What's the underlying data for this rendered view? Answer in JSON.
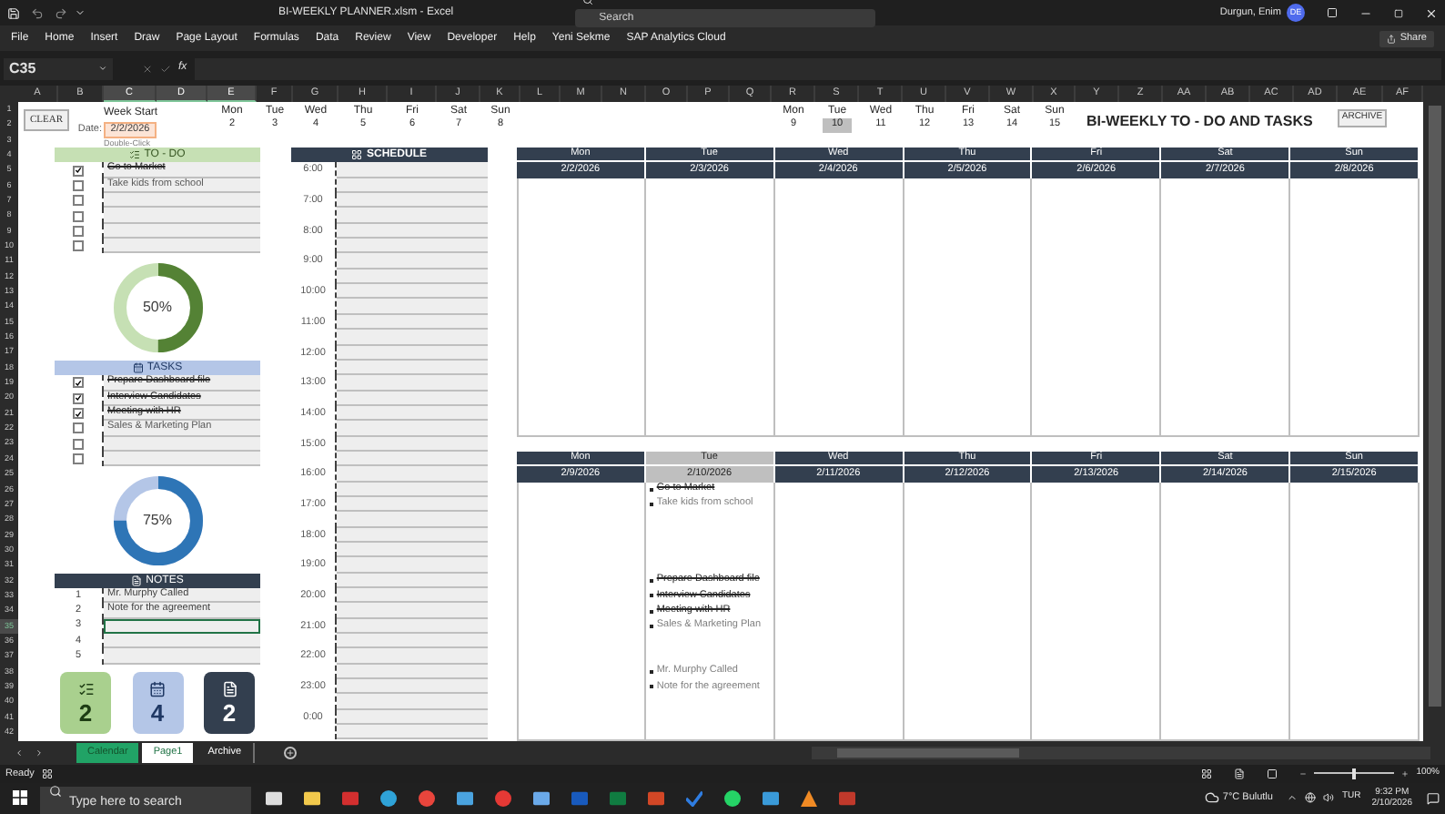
{
  "title_bar": {
    "title": "BI-WEEKLY PLANNER.xlsm - Excel",
    "search_placeholder": "Search",
    "user": "Durgun, Enim",
    "avatar": "DE"
  },
  "ribbon": {
    "tabs": [
      "File",
      "Home",
      "Insert",
      "Draw",
      "Page Layout",
      "Formulas",
      "Data",
      "Review",
      "View",
      "Developer",
      "Help",
      "Yeni Sekme",
      "SAP Analytics Cloud"
    ],
    "share": "Share"
  },
  "formula_bar": {
    "name_box": "C35",
    "function_label": "fx"
  },
  "columns": [
    {
      "label": "A",
      "selected": false
    },
    {
      "label": "B",
      "selected": false
    },
    {
      "label": "C",
      "selected": true
    },
    {
      "label": "D",
      "selected": true
    },
    {
      "label": "E",
      "selected": true
    },
    {
      "label": "F",
      "selected": false
    },
    {
      "label": "G",
      "selected": false
    },
    {
      "label": "H",
      "selected": false
    },
    {
      "label": "I",
      "selected": false
    },
    {
      "label": "J",
      "selected": false
    },
    {
      "label": "K",
      "selected": false
    },
    {
      "label": "L",
      "selected": false
    },
    {
      "label": "M",
      "selected": false
    },
    {
      "label": "N",
      "selected": false
    },
    {
      "label": "O",
      "selected": false
    },
    {
      "label": "P",
      "selected": false
    },
    {
      "label": "Q",
      "selected": false
    },
    {
      "label": "R",
      "selected": false
    },
    {
      "label": "S",
      "selected": false
    },
    {
      "label": "T",
      "selected": false
    },
    {
      "label": "U",
      "selected": false
    },
    {
      "label": "V",
      "selected": false
    },
    {
      "label": "W",
      "selected": false
    },
    {
      "label": "X",
      "selected": false
    },
    {
      "label": "Y",
      "selected": false
    },
    {
      "label": "Z",
      "selected": false
    },
    {
      "label": "AA",
      "selected": false
    },
    {
      "label": "AB",
      "selected": false
    },
    {
      "label": "AC",
      "selected": false
    },
    {
      "label": "AD",
      "selected": false
    },
    {
      "label": "AE",
      "selected": false
    },
    {
      "label": "AF",
      "selected": false
    }
  ],
  "rows": [
    {
      "label": "1",
      "selected": false
    },
    {
      "label": "2",
      "selected": false
    },
    {
      "label": "3",
      "selected": false
    },
    {
      "label": "4",
      "selected": false
    },
    {
      "label": "5",
      "selected": false
    },
    {
      "label": "6",
      "selected": false
    },
    {
      "label": "7",
      "selected": false
    },
    {
      "label": "8",
      "selected": false
    },
    {
      "label": "9",
      "selected": false
    },
    {
      "label": "10",
      "selected": false
    },
    {
      "label": "11",
      "selected": false
    },
    {
      "label": "12",
      "selected": false
    },
    {
      "label": "13",
      "selected": false
    },
    {
      "label": "14",
      "selected": false
    },
    {
      "label": "15",
      "selected": false
    },
    {
      "label": "16",
      "selected": false
    },
    {
      "label": "17",
      "selected": false
    },
    {
      "label": "18",
      "selected": false
    },
    {
      "label": "19",
      "selected": false
    },
    {
      "label": "20",
      "selected": false
    },
    {
      "label": "21",
      "selected": false
    },
    {
      "label": "22",
      "selected": false
    },
    {
      "label": "23",
      "selected": false
    },
    {
      "label": "24",
      "selected": false
    },
    {
      "label": "25",
      "selected": false
    },
    {
      "label": "26",
      "selected": false
    },
    {
      "label": "27",
      "selected": false
    },
    {
      "label": "28",
      "selected": false
    },
    {
      "label": "29",
      "selected": false
    },
    {
      "label": "30",
      "selected": false
    },
    {
      "label": "31",
      "selected": false
    },
    {
      "label": "32",
      "selected": false
    },
    {
      "label": "33",
      "selected": false
    },
    {
      "label": "34",
      "selected": false
    },
    {
      "label": "35",
      "selected": true
    },
    {
      "label": "36",
      "selected": false
    },
    {
      "label": "37",
      "selected": false
    },
    {
      "label": "38",
      "selected": false
    },
    {
      "label": "39",
      "selected": false
    },
    {
      "label": "40",
      "selected": false
    },
    {
      "label": "41",
      "selected": false
    },
    {
      "label": "42",
      "selected": false
    }
  ],
  "sheet": {
    "clear_button": "CLEAR",
    "week_start_label": "Week Start",
    "date_label": "Date:",
    "date_value": "2/2/2026",
    "date_hint": "Double-Click",
    "week_strips": [
      {
        "days": [
          {
            "day": "Mon",
            "number": "2",
            "selected": false
          },
          {
            "day": "Tue",
            "number": "3",
            "selected": false
          },
          {
            "day": "Wed",
            "number": "4",
            "selected": false
          },
          {
            "day": "Thu",
            "number": "5",
            "selected": false
          },
          {
            "day": "Fri",
            "number": "6",
            "selected": false
          },
          {
            "day": "Sat",
            "number": "7",
            "selected": false
          },
          {
            "day": "Sun",
            "number": "8",
            "selected": false
          }
        ]
      },
      {
        "days": [
          {
            "day": "Mon",
            "number": "9",
            "selected": false
          },
          {
            "day": "Tue",
            "number": "10",
            "selected": true
          },
          {
            "day": "Wed",
            "number": "11",
            "selected": false
          },
          {
            "day": "Thu",
            "number": "12",
            "selected": false
          },
          {
            "day": "Fri",
            "number": "13",
            "selected": false
          },
          {
            "day": "Sat",
            "number": "14",
            "selected": false
          },
          {
            "day": "Sun",
            "number": "15",
            "selected": false
          }
        ]
      }
    ],
    "title": "BI-WEEKLY TO - DO AND TASKS",
    "archive_button": "ARCHIVE",
    "todo": {
      "title": "TO - DO",
      "items": [
        {
          "text": "Go to Market",
          "checked": true
        },
        {
          "text": "Take kids from school",
          "checked": false
        },
        {
          "checked": false
        },
        {
          "checked": false
        },
        {
          "checked": false
        },
        {
          "checked": false
        }
      ],
      "level": 0.5,
      "percent": "50%"
    },
    "tasks": {
      "title": "TASKS",
      "items": [
        {
          "text": "Prepare Dashboard file",
          "checked": true
        },
        {
          "text": "Interview Candidates",
          "checked": true
        },
        {
          "text": "Meeting with HR",
          "checked": true
        },
        {
          "text": "Sales & Marketing Plan",
          "checked": false
        },
        {
          "checked": false
        },
        {
          "checked": false
        }
      ],
      "level": 0.75,
      "percent": "75%"
    },
    "notes": {
      "title": "NOTES",
      "items": [
        {
          "number": "1",
          "text": "Mr. Murphy Called",
          "selected": false
        },
        {
          "number": "2",
          "text": "Note for the agreement",
          "selected": false
        },
        {
          "number": "3",
          "selected": true
        },
        {
          "number": "4",
          "selected": false
        },
        {
          "number": "5",
          "selected": false
        }
      ]
    },
    "counters": [
      {
        "kind": "todo",
        "count": "2"
      },
      {
        "kind": "tasks",
        "count": "4"
      },
      {
        "kind": "notes",
        "count": "2"
      }
    ],
    "schedule": {
      "title": "SCHEDULE",
      "times": [
        "6:00",
        "7:00",
        "8:00",
        "9:00",
        "10:00",
        "11:00",
        "12:00",
        "13:00",
        "14:00",
        "15:00",
        "16:00",
        "17:00",
        "18:00",
        "19:00",
        "20:00",
        "21:00",
        "22:00",
        "23:00",
        "0:00"
      ]
    },
    "calendar_weeks": [
      {
        "days": [
          {
            "day": "Mon",
            "date": "2/2/2026",
            "selected": false
          },
          {
            "day": "Tue",
            "date": "2/3/2026",
            "selected": false
          },
          {
            "day": "Wed",
            "date": "2/4/2026",
            "selected": false
          },
          {
            "day": "Thu",
            "date": "2/5/2026",
            "selected": false
          },
          {
            "day": "Fri",
            "date": "2/6/2026",
            "selected": false
          },
          {
            "day": "Sat",
            "date": "2/7/2026",
            "selected": false
          },
          {
            "day": "Sun",
            "date": "2/8/2026",
            "selected": false
          }
        ]
      },
      {
        "days": [
          {
            "day": "Mon",
            "date": "2/9/2026",
            "selected": false
          },
          {
            "day": "Tue",
            "date": "2/10/2026",
            "selected": true,
            "entry_groups": [
              {
                "entries": [
                  {
                    "text": "Go to Market",
                    "done": true
                  },
                  {
                    "text": "Take kids from school",
                    "done": false
                  }
                ]
              },
              {
                "entries": [
                  {
                    "text": "Prepare Dashboard file",
                    "done": true
                  },
                  {
                    "text": "Interview Candidates",
                    "done": true
                  },
                  {
                    "text": "Meeting with HR",
                    "done": true
                  },
                  {
                    "text": "Sales & Marketing Plan",
                    "done": false
                  }
                ]
              },
              {
                "entries": [
                  {
                    "text": "Mr. Murphy Called",
                    "done": false
                  },
                  {
                    "text": "Note for the agreement",
                    "done": false
                  }
                ]
              }
            ]
          },
          {
            "day": "Wed",
            "date": "2/11/2026",
            "selected": false
          },
          {
            "day": "Thu",
            "date": "2/12/2026",
            "selected": false
          },
          {
            "day": "Fri",
            "date": "2/13/2026",
            "selected": false
          },
          {
            "day": "Sat",
            "date": "2/14/2026",
            "selected": false
          },
          {
            "day": "Sun",
            "date": "2/15/2026",
            "selected": false
          }
        ]
      }
    ]
  },
  "sheet_tabs": [
    {
      "label": "Calendar",
      "selected": false,
      "color": "#21a366"
    },
    {
      "label": "Page1",
      "selected": true
    },
    {
      "label": "Archive",
      "selected": false
    }
  ],
  "status_bar": {
    "text": "Ready",
    "zoom": "100%",
    "zoom_slider": {
      "level": 0.5
    }
  },
  "taskbar": {
    "search_placeholder": "Type here to search",
    "weather": "7°C Bulutlu",
    "language": "TUR",
    "time": "9:32 PM",
    "date": "2/10/2026"
  }
}
